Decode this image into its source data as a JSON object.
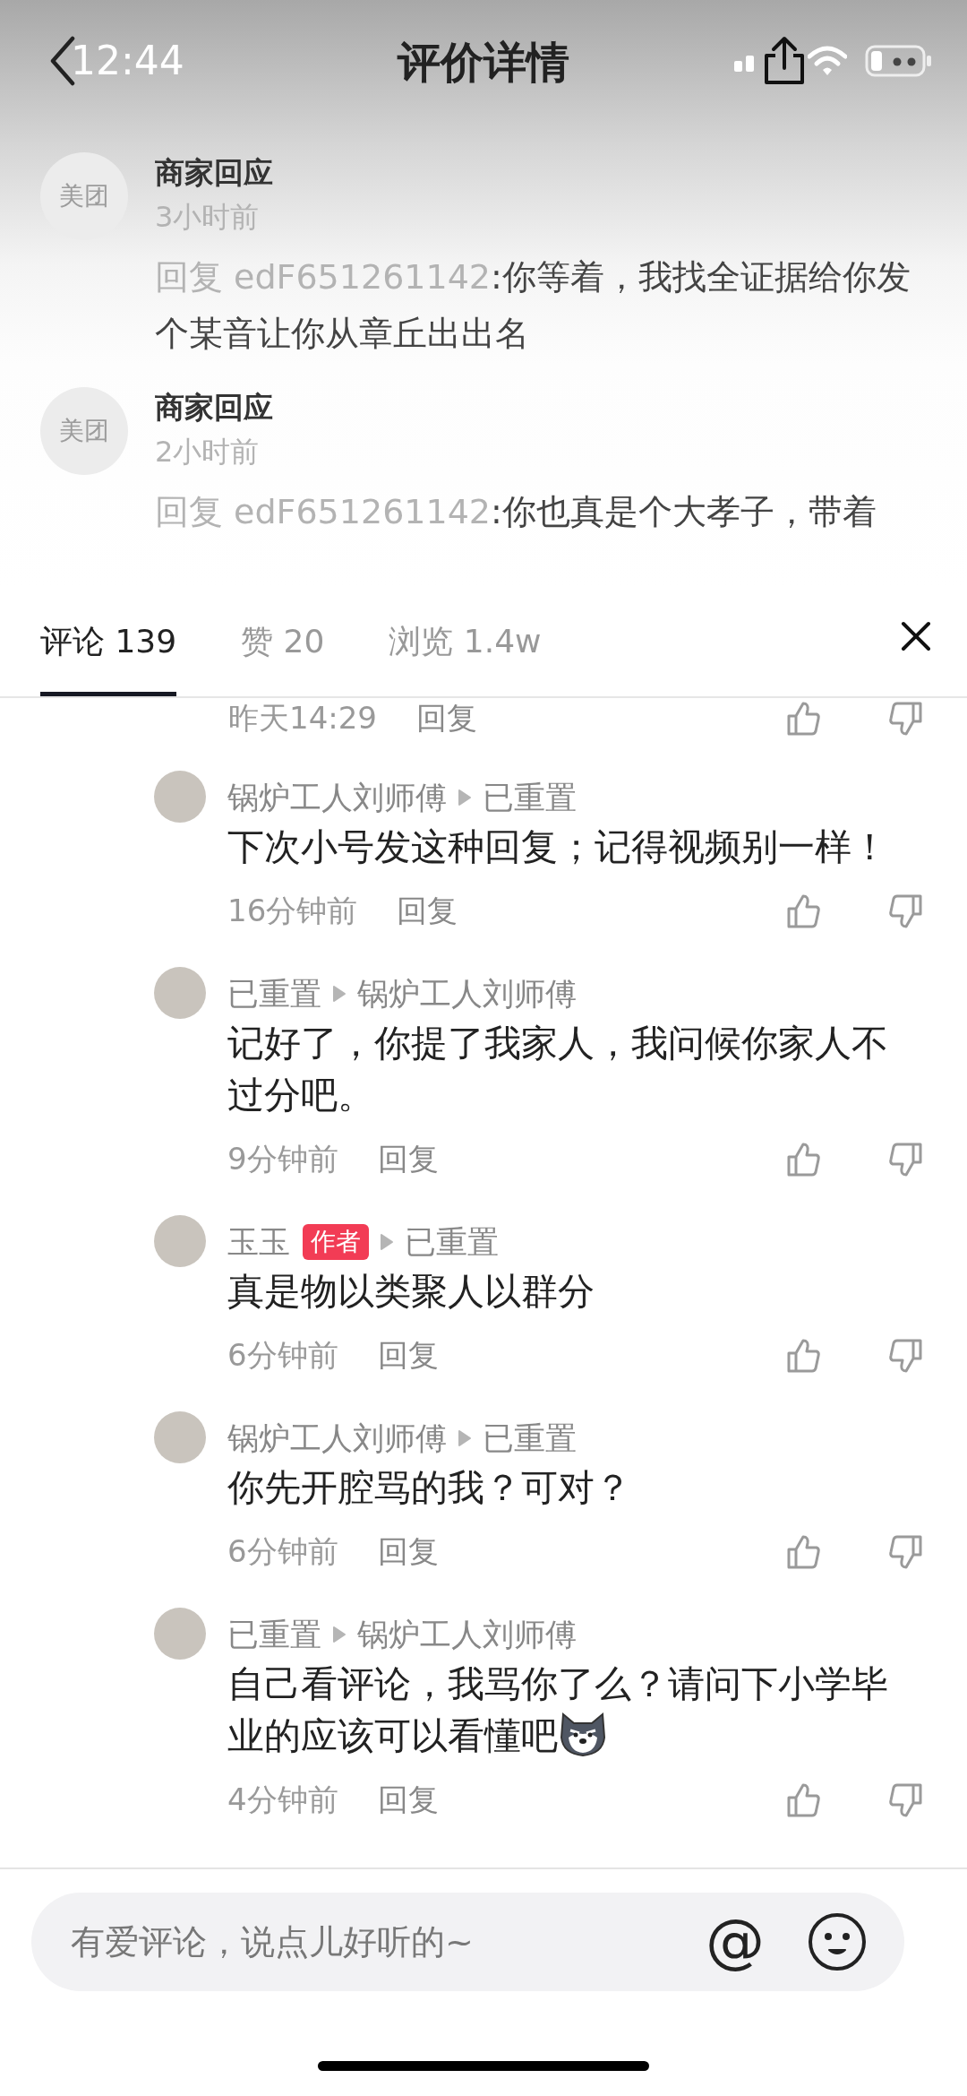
{
  "status_bar": {
    "time": "12:44"
  },
  "header": {
    "title": "评价详情"
  },
  "merchant_replies": [
    {
      "name": "商家回应",
      "avatar_text": "美团",
      "time": "3小时前",
      "reply_prefix": "回复 edF651261142",
      "text": ":你等着，我找全证据给你发个某音让你从章丘出出名"
    },
    {
      "name": "商家回应",
      "avatar_text": "美团",
      "time": "2小时前",
      "reply_prefix": "回复 edF651261142",
      "text": ":你也真是个大孝子，带着"
    }
  ],
  "tabs": [
    {
      "label": "评论 139",
      "selected": true
    },
    {
      "label": "赞 20",
      "selected": false
    },
    {
      "label": "浏览 1.4w",
      "selected": false
    }
  ],
  "partial_comment": {
    "time": "昨天14:29",
    "reply_label": "回复"
  },
  "comments": [
    {
      "author": "锅炉工人刘师傅",
      "reply_to": "已重置",
      "text": "下次小号发这种回复；记得视频别一样！",
      "time": "16分钟前",
      "reply_label": "回复",
      "has_emoji": false
    },
    {
      "author": "已重置",
      "reply_to": "锅炉工人刘师傅",
      "text": "记好了，你提了我家人，我问候你家人不过分吧。",
      "time": "9分钟前",
      "reply_label": "回复",
      "has_emoji": false
    },
    {
      "author": "玉玉",
      "author_badge": "作者",
      "reply_to": "已重置",
      "text": "真是物以类聚人以群分",
      "time": "6分钟前",
      "reply_label": "回复",
      "has_emoji": false
    },
    {
      "author": "锅炉工人刘师傅",
      "reply_to": "已重置",
      "text": "你先开腔骂的我？可对？",
      "time": "6分钟前",
      "reply_label": "回复",
      "has_emoji": false
    },
    {
      "author": "已重置",
      "reply_to": "锅炉工人刘师傅",
      "text": "自己看评论，我骂你了么？请问下小学毕业的应该可以看懂吧",
      "time": "4分钟前",
      "reply_label": "回复",
      "has_emoji": true
    }
  ],
  "comment_input": {
    "placeholder": "有爱评论，说点儿好听的~",
    "mention_symbol": "@"
  }
}
